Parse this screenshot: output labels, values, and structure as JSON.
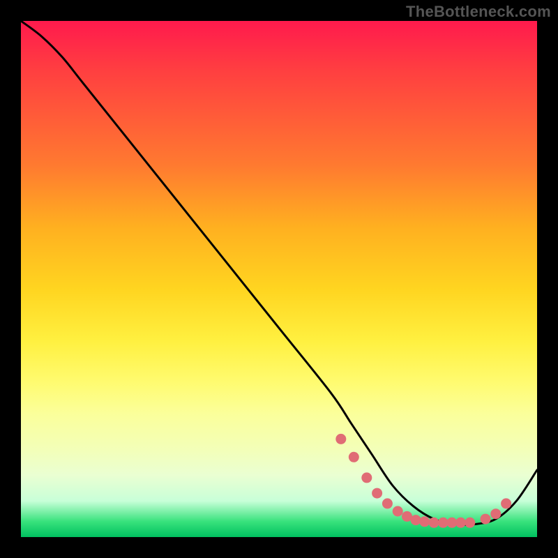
{
  "watermark": "TheBottleneck.com",
  "chart_data": {
    "type": "line",
    "title": "",
    "xlabel": "",
    "ylabel": "",
    "xlim": [
      0,
      100
    ],
    "ylim": [
      0,
      100
    ],
    "gradient_stops": [
      {
        "pct": 0,
        "color": "#ff1a4d"
      },
      {
        "pct": 10,
        "color": "#ff4040"
      },
      {
        "pct": 28,
        "color": "#ff7a30"
      },
      {
        "pct": 40,
        "color": "#ffb020"
      },
      {
        "pct": 52,
        "color": "#ffd520"
      },
      {
        "pct": 62,
        "color": "#fff040"
      },
      {
        "pct": 70,
        "color": "#fffb70"
      },
      {
        "pct": 76,
        "color": "#fbff9a"
      },
      {
        "pct": 83,
        "color": "#f3ffb8"
      },
      {
        "pct": 88,
        "color": "#eaffd2"
      },
      {
        "pct": 93,
        "color": "#c8ffd8"
      },
      {
        "pct": 97,
        "color": "#38e27c"
      },
      {
        "pct": 100,
        "color": "#00c060"
      }
    ],
    "series": [
      {
        "name": "curve",
        "x": [
          0,
          4,
          8,
          12,
          20,
          30,
          40,
          50,
          60,
          64,
          68,
          72,
          76,
          80,
          84,
          88,
          92,
          96,
          100
        ],
        "y": [
          100,
          97,
          93,
          88,
          78,
          65.5,
          53,
          40.5,
          28,
          22,
          16,
          10,
          6,
          3.5,
          2.5,
          2.5,
          3.5,
          7,
          13
        ]
      }
    ],
    "markers": {
      "name": "dots",
      "color": "#e06c75",
      "radius": 7.5,
      "x": [
        62,
        64.5,
        67,
        69,
        71,
        73,
        74.8,
        76.5,
        78.2,
        80,
        81.8,
        83.5,
        85.2,
        87,
        90,
        92,
        94
      ],
      "y": [
        19,
        15.5,
        11.5,
        8.5,
        6.5,
        5,
        4,
        3.3,
        3,
        2.8,
        2.8,
        2.8,
        2.8,
        2.8,
        3.5,
        4.5,
        6.5
      ]
    }
  }
}
